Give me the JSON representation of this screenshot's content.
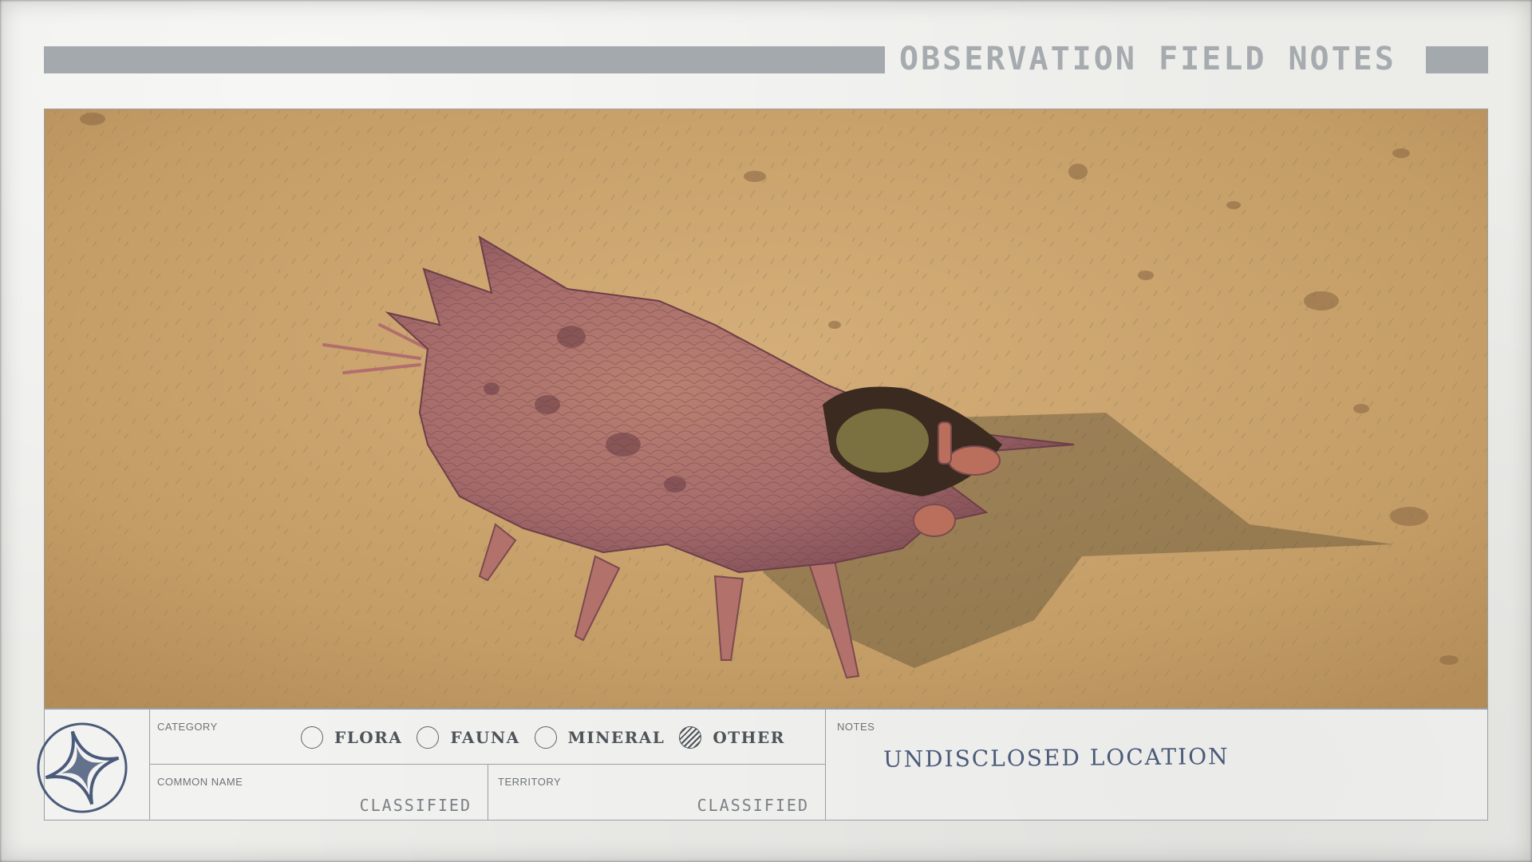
{
  "header": {
    "title": "OBSERVATION FIELD NOTES"
  },
  "photo": {
    "subject": "spiked-shell-creature",
    "ground_color": "#c9a36f",
    "shell_color": "#a56b6a"
  },
  "form": {
    "category": {
      "label": "CATEGORY",
      "options": [
        {
          "label": "FLORA",
          "selected": false
        },
        {
          "label": "FAUNA",
          "selected": false
        },
        {
          "label": "MINERAL",
          "selected": false
        },
        {
          "label": "OTHER",
          "selected": true
        }
      ]
    },
    "common_name": {
      "label": "COMMON NAME",
      "value": "CLASSIFIED"
    },
    "territory": {
      "label": "TERRITORY",
      "value": "CLASSIFIED"
    },
    "notes": {
      "label": "NOTES",
      "value": "UNDISCLOSED LOCATION"
    },
    "emblem_icon": "star-emblem-icon"
  },
  "colors": {
    "paper": "#ecece9",
    "header_bar": "#a4a9ad",
    "ink": "#4e5459",
    "handwriting": "#4a5a7a"
  }
}
